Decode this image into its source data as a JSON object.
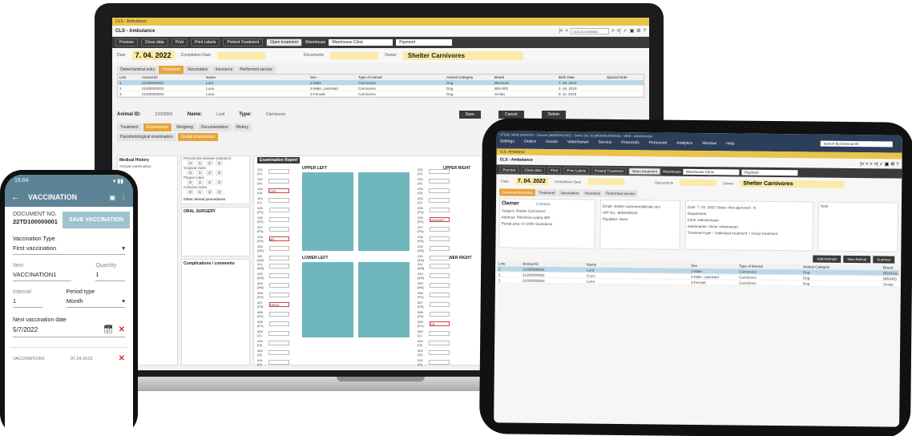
{
  "laptop": {
    "window_tab": "CLS - Ambulance",
    "title": "CLS - Ambulance",
    "nav_search": "CLS-CLS-000001",
    "toolbar": {
      "preview": "Preview",
      "close_data": "Close data",
      "print": "Print",
      "print_labels": "Print Labels",
      "print_treatment": "Printed Treatment",
      "open_treatment": "Open treatment",
      "warehouse_label": "Warehouse",
      "warehouse_value": "Warehouse Clinic",
      "payment": "Payment"
    },
    "date_label": "Date",
    "date_value": "7. 04. 2022",
    "completion_label": "Completion Date",
    "documents_label": "Documents",
    "owner_label": "Owner",
    "owner_value": "Shelter Carnivores",
    "tabs": [
      "Owner/animal entry",
      "Treatment",
      "Vaccination",
      "Insurance",
      "Performed service"
    ],
    "table_headers": [
      "Line",
      "Animal ID",
      "Name",
      "Sex",
      "Type of Animal",
      "Animal Category",
      "Breed",
      "Birth Date",
      "Special Note"
    ],
    "table_rows": [
      [
        "1",
        "21000000001",
        "Lord",
        "1-Male",
        "Carnivores",
        "Dog",
        "BEAGLE",
        "7. 08. 2019",
        ""
      ],
      [
        "2",
        "21000000002",
        "Luna",
        "2-Male, castrated",
        "Carnivores",
        "Dog",
        "BRIARD",
        "3. 06. 2019",
        ""
      ],
      [
        "3",
        "21000000003",
        "Luna",
        "2-Female",
        "Carnivores",
        "Dog",
        "Smida",
        "9. 11. 2019",
        ""
      ]
    ],
    "animal_id_label": "Animal ID:",
    "animal_id_value": "21000001",
    "name_label": "Name:",
    "name_value": "Lord",
    "type_label": "Type:",
    "type_value": "Carnivores",
    "btn_save": "Save",
    "btn_cancel": "Cancel",
    "btn_delete": "Delete",
    "subtabs": [
      "Treatment",
      "Examination",
      "Weighing",
      "Documentation",
      "History"
    ],
    "subtabs2": [
      "Parodontological examination",
      "Dental examination"
    ],
    "medical_history_title": "Medical History",
    "medical_history_sub": "Annual examination",
    "periodontal_title": "Periodontal disease (stadium)",
    "gingival_index": "Gingival index",
    "plaque_index": "Plaque index",
    "calculus_index": "Calculus index",
    "scale": [
      "0",
      "1",
      "2",
      "3"
    ],
    "oral_surgery": "ORAL SURGERY",
    "other_dental": "Other dental procedures",
    "complications": "Complications / comments",
    "upper_left": "UPPER LEFT",
    "upper_right": "UPPER RIGHT",
    "lower_left": "LOWER LEFT",
    "lower_right": "LOWER RIGHT",
    "exam_button": "Examination Report",
    "left_teeth_upper": [
      "101 (I1)",
      "102 (I2)",
      "103 (I3)",
      "104 (C)",
      "105 (P1)",
      "106 (P2)",
      "107 (P3)",
      "108 (P4)",
      "109 (M1)",
      "110 (M2)"
    ],
    "right_teeth_upper": [
      "201 (I1)",
      "202 (I2)",
      "203 (I3)",
      "204 (C)",
      "205 (P1)",
      "206 (P2)",
      "207 (P3)",
      "208 (P4)",
      "209 (M1)",
      "210 (M2)"
    ],
    "left_teeth_lower": [
      "411 (M3)",
      "410 (M2)",
      "409 (M1)",
      "408 (P4)",
      "407 (P3)",
      "406 (P2)",
      "405 (P1)",
      "404 (C)",
      "403 (I3)",
      "402 (I2)",
      "401 (I1)"
    ],
    "right_teeth_lower": [
      "311 (M3)",
      "310 (M2)",
      "309 (M1)",
      "308 (P4)",
      "307 (P3)",
      "306 (P2)",
      "305 (P1)",
      "304 (C)",
      "303 (I3)",
      "302 (I2)",
      "301 (I1)"
    ],
    "marks": {
      "u103": "CHO",
      "u108": "AR",
      "u206": "CHO/GET",
      "l407": "GROX",
      "r305": "CR"
    }
  },
  "tablet": {
    "menubar_title": "STEAD WEB SERVICE - Ovocna (WAREHOUSE) - Demo Sw, 03 (MODRA AREINA) - WAR - Administrator",
    "menus": [
      "Settings",
      "Orders",
      "Goods",
      "Veterinarian",
      "Service",
      "Financials",
      "Personnel",
      "Analytics",
      "Window",
      "Help"
    ],
    "search": "search By External ID",
    "tab": "CLS - Ambulance",
    "title": "CLS - Ambulance",
    "toolbar": [
      "Preview",
      "Close data",
      "Print",
      "Print Labels",
      "Printed Treatment"
    ],
    "open_treatment": "Open treatment",
    "warehouse_label": "Warehouse",
    "warehouse_value": "Warehouse Clinic",
    "payment": "Payment",
    "date_label": "Date",
    "date_value": "7. 04. 2022",
    "completion_label": "Completion Date",
    "documents_label": "Documents",
    "owner_label": "Owner",
    "owner_value": "Shelter Carnivores",
    "tabs": [
      "Owner/animal entry",
      "Treatment",
      "Vaccination",
      "Insurance",
      "Performed service"
    ],
    "owner_box_title": "Owner",
    "owner_contact": "Contacts",
    "owner_subject": "Subject: Shelter Carnivores",
    "owner_address": "Address: Polní/Hra-uvaha 380",
    "owner_postal": "Postal area: Fr-1000   Suchdome",
    "email_label": "Email",
    "email_value": "shelter-carnivores@mail.com",
    "vat_label": "VAT No.",
    "vat_value": "9002199124",
    "payables_label": "Payables",
    "payables_value": "None",
    "date2_label": "Date",
    "date2_value": "7. 04. 2022",
    "status_label": "Status",
    "status_value": "Not approved - N",
    "department_label": "Department",
    "clerk_label": "Clerk",
    "clerk_value": "Administrator",
    "vet_label": "Veterinarian",
    "vet_value": "Victor Veterinarian",
    "treatment_type": "Treatment type",
    "individual": "Individual treatment",
    "group": "Group treatment",
    "note_label": "Note",
    "btn_add": "Add Animals",
    "btn_new": "New Animal",
    "btn_summar": "Summar",
    "table_headers": [
      "Line",
      "Animal ID",
      "Name",
      "Sex",
      "Type of Animal",
      "Animal Category",
      "Breed"
    ],
    "table_rows": [
      [
        "1",
        "21000000001",
        "Lord",
        "1-Male",
        "Carnivores",
        "Dog",
        "BEAGLE"
      ],
      [
        "2",
        "21000000002",
        "Coco",
        "2-Male, castrated",
        "Carnivores",
        "Dog",
        "BRIARD"
      ],
      [
        "3",
        "21000000003",
        "Luna",
        "2-Female",
        "Carnivores",
        "Dog",
        "Smida"
      ]
    ]
  },
  "phone": {
    "time": "15:04",
    "signal": "▾ ▮▮",
    "title": "VACCINATION",
    "doc_label": "DOCUMENT NO.",
    "doc_value": "22TD100000001",
    "save_button": "SAVE VACCINATION",
    "vaccination_type_label": "Vaccination Type",
    "vaccination_type_value": "First vaccination",
    "item_label": "Item",
    "item_value": "VACCINATION1",
    "quantity_label": "Quantity",
    "quantity_value": "1",
    "interval_label": "Interval",
    "interval_value": "1",
    "period_label": "Period type",
    "period_value": "Month",
    "next_label": "Next vaccination date",
    "next_value": "5/7/2022",
    "history_item": "VACCINATION1",
    "history_date": "97.04.2023"
  },
  "colors": {
    "accent": "#e8a33c",
    "highlight": "#fbeaa8",
    "teeth_bg": "#6fb6bd",
    "phone_header": "#5d8496",
    "danger": "#d03030"
  }
}
